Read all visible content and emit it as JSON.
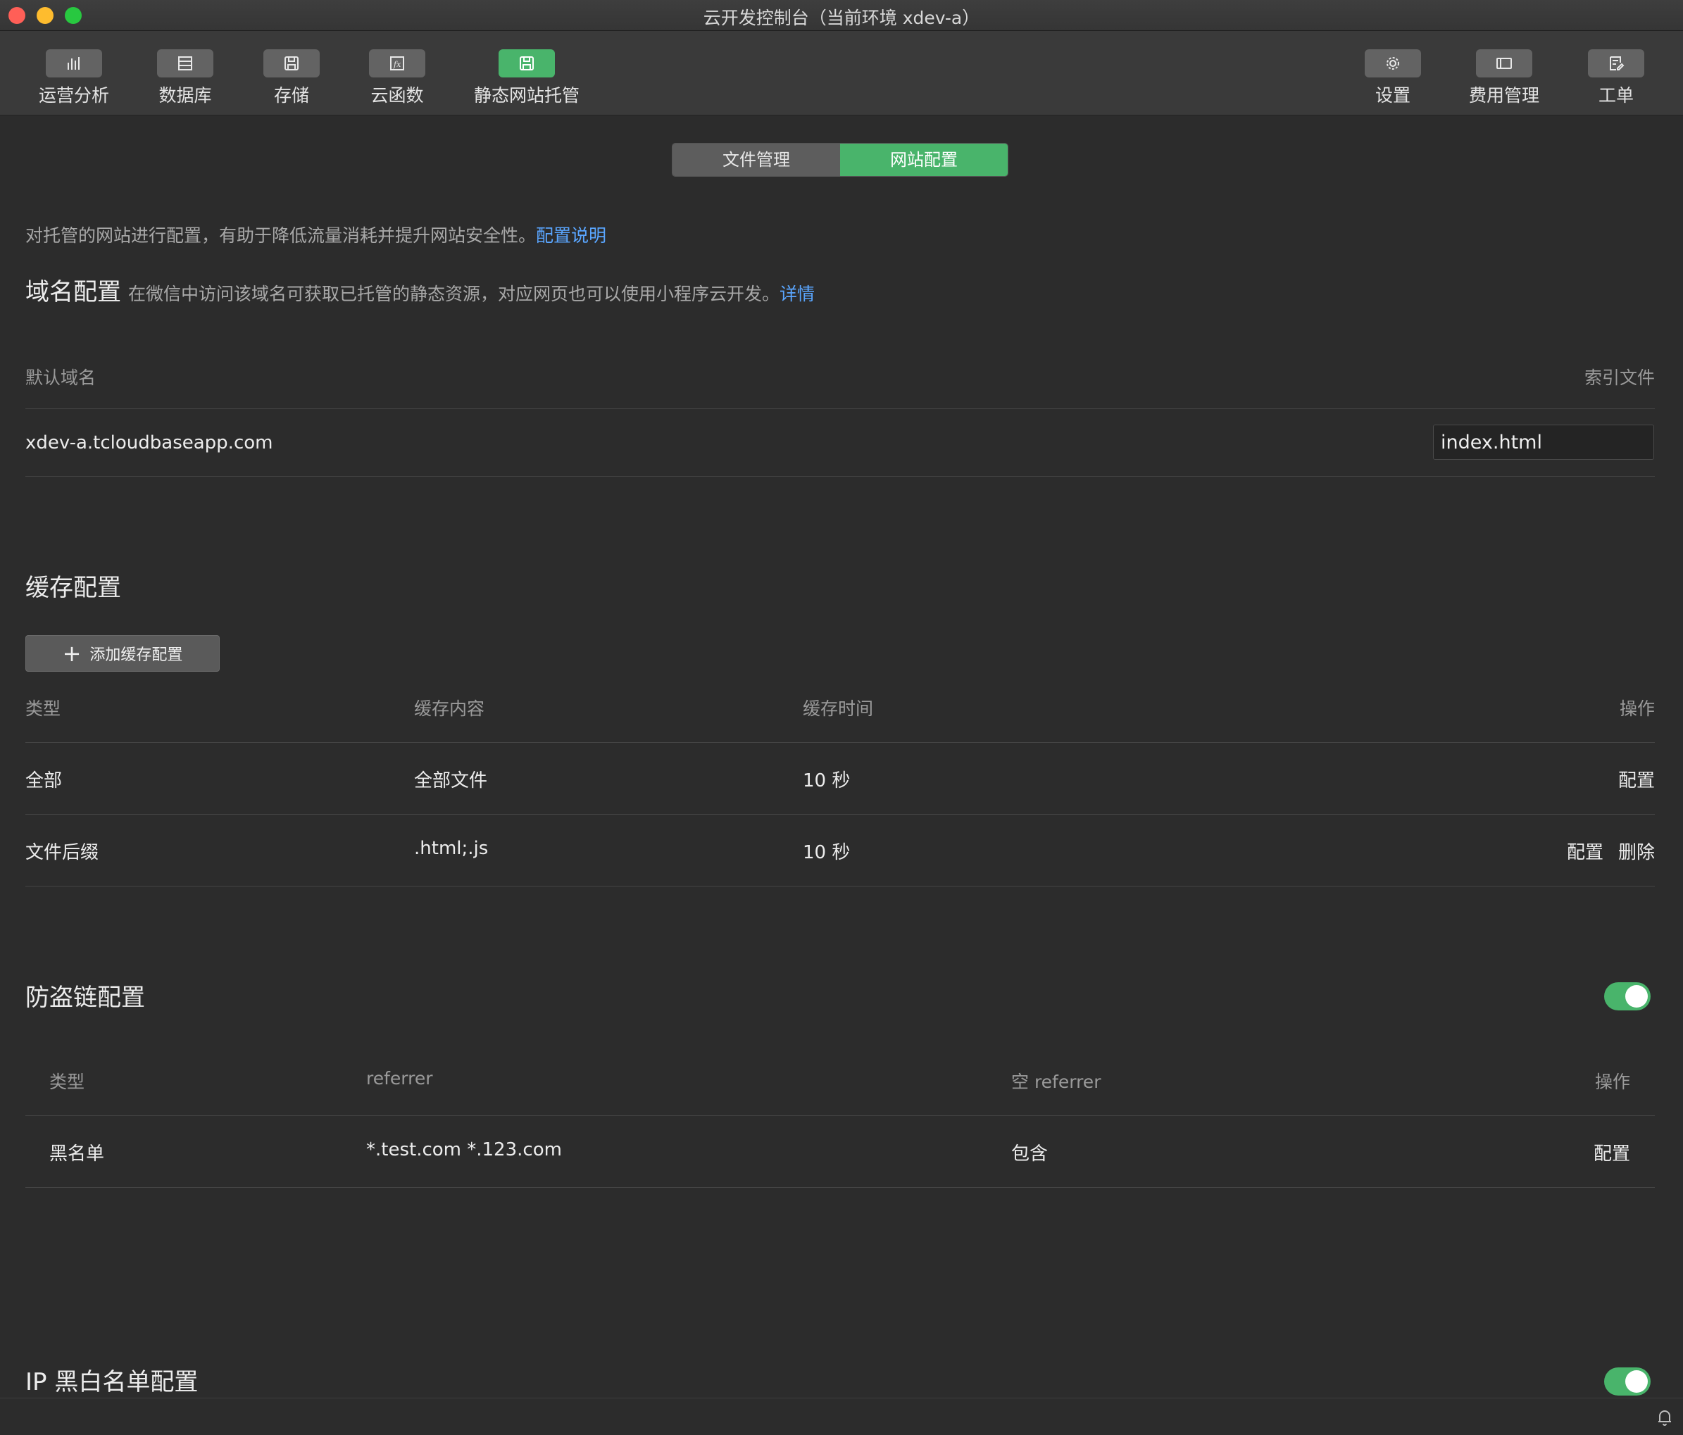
{
  "window": {
    "title": "云开发控制台（当前环境 xdev-a）"
  },
  "toolbar": {
    "left": [
      {
        "label": "运营分析",
        "icon": "bar-chart-icon"
      },
      {
        "label": "数据库",
        "icon": "database-icon"
      },
      {
        "label": "存储",
        "icon": "storage-icon"
      },
      {
        "label": "云函数",
        "icon": "function-icon"
      },
      {
        "label": "静态网站托管",
        "icon": "static-site-icon",
        "active": true
      }
    ],
    "right": [
      {
        "label": "设置",
        "icon": "gear-icon"
      },
      {
        "label": "费用管理",
        "icon": "billing-icon"
      },
      {
        "label": "工单",
        "icon": "ticket-icon"
      }
    ]
  },
  "tabs": [
    {
      "label": "文件管理",
      "selected": false
    },
    {
      "label": "网站配置",
      "selected": true
    }
  ],
  "intro": {
    "text": "对托管的网站进行配置，有助于降低流量消耗并提升网站安全性。",
    "link": "配置说明"
  },
  "domain": {
    "title": "域名配置",
    "subtitle": "在微信中访问该域名可获取已托管的静态资源，对应网页也可以使用小程序云开发。",
    "link": "详情",
    "col_domain": "默认域名",
    "col_index": "索引文件",
    "domain_value": "xdev-a.tcloudbaseapp.com",
    "index_value": "index.html"
  },
  "cache": {
    "title": "缓存配置",
    "add_button": "添加缓存配置",
    "columns": [
      "类型",
      "缓存内容",
      "缓存时间",
      "操作"
    ],
    "rows": [
      {
        "type": "全部",
        "content": "全部文件",
        "time": "10 秒",
        "actions": [
          "配置"
        ]
      },
      {
        "type": "文件后缀",
        "content": ".html;.js",
        "time": "10 秒",
        "actions": [
          "配置",
          "删除"
        ]
      }
    ]
  },
  "hotlink": {
    "title": "防盗链配置",
    "enabled": true,
    "columns": [
      "类型",
      "referrer",
      "空 referrer",
      "操作"
    ],
    "rows": [
      {
        "type": "黑名单",
        "referrer": "*.test.com *.123.com",
        "empty_referrer": "包含",
        "action": "配置"
      }
    ]
  },
  "ip": {
    "title": "IP 黑白名单配置",
    "enabled": true
  },
  "colors": {
    "accent": "#49b46b",
    "link": "#5aa6ff",
    "background": "#2c2c2c"
  }
}
